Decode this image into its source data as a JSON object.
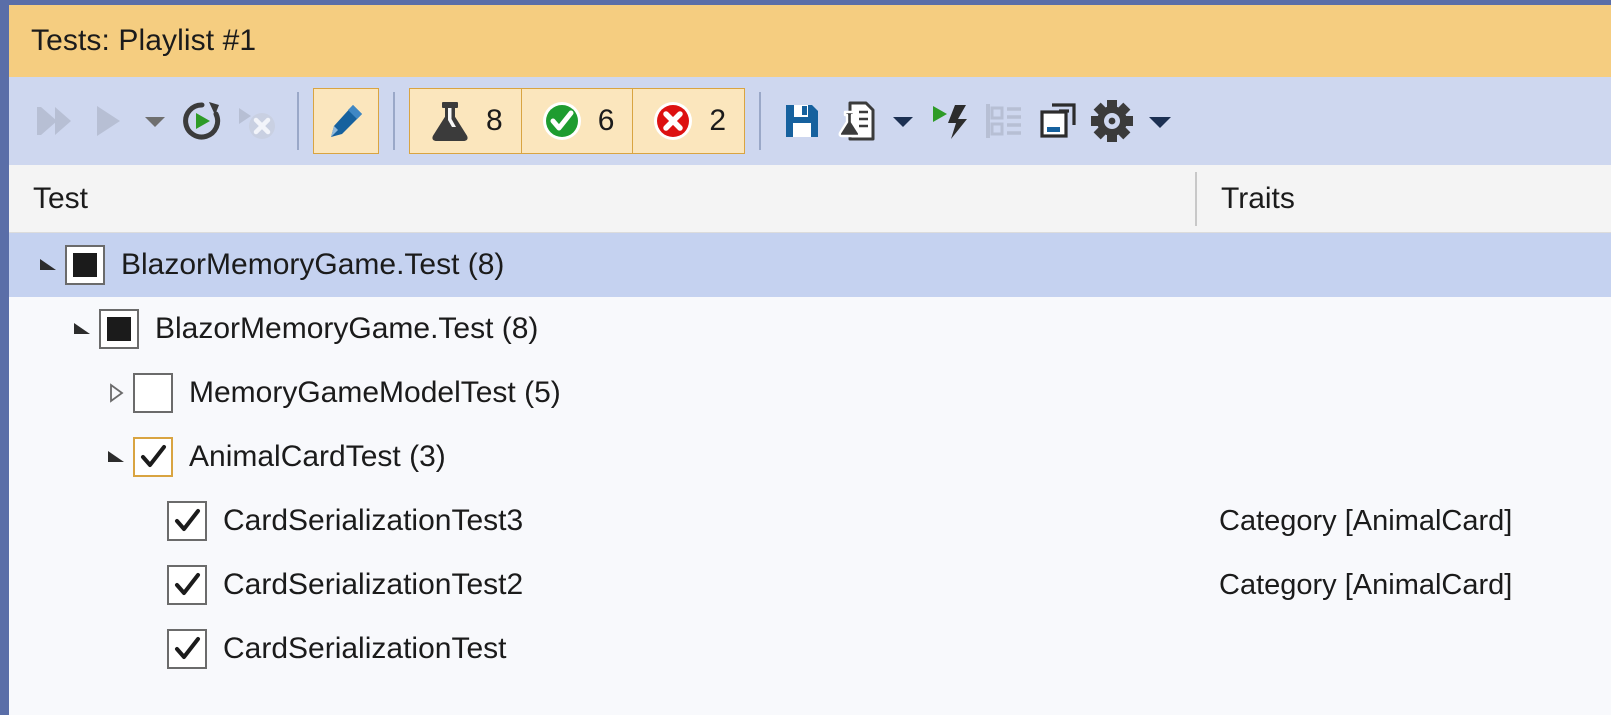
{
  "window": {
    "title": "Tests: Playlist #1"
  },
  "colors": {
    "title_bar_bg": "#f5cd80",
    "toolbar_bg": "#ced7ef",
    "selection_bg": "#c5d2f0",
    "panel_border": "#5a6ea8",
    "toggle_bg": "#fbe6bd",
    "toggle_border": "#d9a441",
    "passed_green": "#1e9c30",
    "failed_red": "#dd1111",
    "save_blue": "#16619e"
  },
  "toolbar": {
    "left_group": [
      {
        "name": "run-all-tests-button",
        "icon": "run-all-icon",
        "enabled": false
      },
      {
        "name": "run-button",
        "icon": "play-icon",
        "enabled": false
      },
      {
        "name": "run-dropdown-button",
        "icon": "chevron-down-icon",
        "enabled": false
      },
      {
        "name": "repeat-last-run-button",
        "icon": "rerun-icon",
        "enabled": true
      },
      {
        "name": "stop-button",
        "icon": "stop-icon",
        "enabled": false
      }
    ],
    "edit_button": {
      "name": "edit-playlist-button",
      "icon": "pencil-icon",
      "selected": true
    },
    "filters": [
      {
        "name": "filter-total-tests",
        "icon": "flask-icon",
        "count": "8"
      },
      {
        "name": "filter-passed-tests",
        "icon": "check-circle-icon",
        "count": "6"
      },
      {
        "name": "filter-failed-tests",
        "icon": "error-circle-icon",
        "count": "2"
      }
    ],
    "right_group": [
      {
        "name": "save-playlist-button",
        "icon": "save-icon",
        "enabled": true
      },
      {
        "name": "test-document-button",
        "icon": "test-document-icon",
        "enabled": true
      },
      {
        "name": "test-document-dropdown-button",
        "icon": "chevron-down-icon",
        "enabled": true
      },
      {
        "name": "run-with-profiler-button",
        "icon": "play-lightning-icon",
        "enabled": true
      },
      {
        "name": "group-by-button",
        "icon": "group-by-icon",
        "enabled": false
      },
      {
        "name": "copy-window-button",
        "icon": "copy-window-icon",
        "enabled": true
      },
      {
        "name": "settings-button",
        "icon": "gear-icon",
        "enabled": true
      },
      {
        "name": "settings-dropdown-button",
        "icon": "chevron-down-icon",
        "enabled": true
      }
    ]
  },
  "columns": {
    "test": "Test",
    "traits": "Traits"
  },
  "tree": {
    "rows": [
      {
        "label": "BlazorMemoryGame.Test  (8)",
        "indent": 0,
        "twisty": "expanded",
        "check": "partial",
        "focused": false,
        "selected": true,
        "traits": ""
      },
      {
        "label": "BlazorMemoryGame.Test  (8)",
        "indent": 1,
        "twisty": "expanded",
        "check": "partial",
        "focused": false,
        "selected": false,
        "traits": ""
      },
      {
        "label": "MemoryGameModelTest  (5)",
        "indent": 2,
        "twisty": "collapsed",
        "check": "unchecked",
        "focused": false,
        "selected": false,
        "traits": ""
      },
      {
        "label": "AnimalCardTest  (3)",
        "indent": 2,
        "twisty": "expanded",
        "check": "checked",
        "focused": true,
        "selected": false,
        "traits": ""
      },
      {
        "label": "CardSerializationTest3",
        "indent": 3,
        "twisty": "none",
        "check": "checked",
        "focused": false,
        "selected": false,
        "traits": "Category [AnimalCard]"
      },
      {
        "label": "CardSerializationTest2",
        "indent": 3,
        "twisty": "none",
        "check": "checked",
        "focused": false,
        "selected": false,
        "traits": "Category [AnimalCard]"
      },
      {
        "label": "CardSerializationTest",
        "indent": 3,
        "twisty": "none",
        "check": "checked",
        "focused": false,
        "selected": false,
        "traits": ""
      }
    ]
  }
}
